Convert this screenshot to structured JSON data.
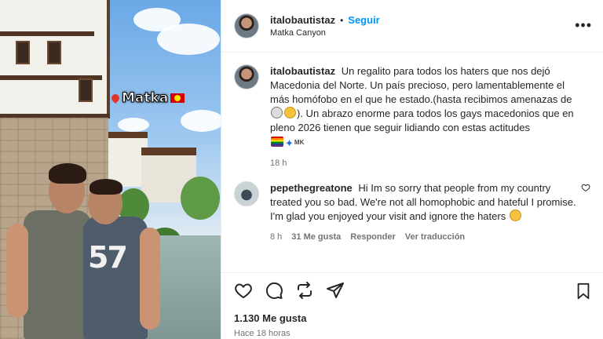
{
  "post": {
    "username": "italobautistaz",
    "separator": "•",
    "follow_label": "Seguir",
    "location": "Matka Canyon",
    "more_icon": "more-options-icon"
  },
  "photo": {
    "sticker_text": "Matka",
    "shirt_number": "57"
  },
  "caption": {
    "username": "italobautistaz",
    "text_1": "Un regalito para todos los haters que nos dejó Macedonia del Norte. Un país precioso, pero lamentablemente el más homófobo en el que he estado.(hasta recibimos amenazas de",
    "text_2": "). Un abrazo enorme para todos los gays macedonios que en pleno 2026 tienen que seguir lidiando con estas actitudes",
    "flag_code": "MK",
    "time": "18 h"
  },
  "comment": {
    "username": "pepethegreatone",
    "text": "Hi Im so sorry that people from my country treated you so bad. We're not all homophobic and hateful I promise. I'm glad you enjoyed your visit and ignore the haters",
    "time": "8 h",
    "likes": "31 Me gusta",
    "reply": "Responder",
    "translate": "Ver traducción"
  },
  "footer": {
    "likes": "1.130 Me gusta",
    "posted": "Hace 18 horas"
  }
}
